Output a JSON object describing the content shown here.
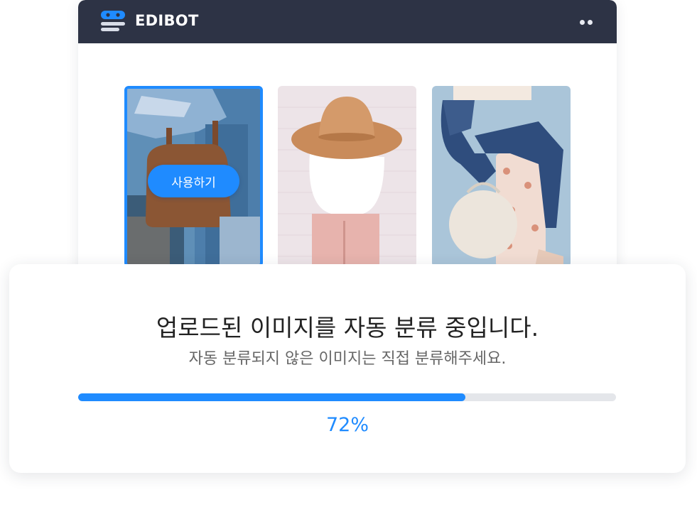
{
  "app": {
    "title": "EDIBOT",
    "logo_icon": "robot-logo-icon",
    "menu_icon": "more-dots-icon"
  },
  "gallery": {
    "cards": [
      {
        "name": "handbag-photo",
        "selected": true,
        "action_label": "사용하기"
      },
      {
        "name": "sun-hat-photo",
        "selected": false
      },
      {
        "name": "round-bag-photo",
        "selected": false
      }
    ]
  },
  "progress": {
    "title": "업로드된 이미지를 자동 분류 중입니다.",
    "subtitle": "자동 분류되지 않은 이미지는 직접 분류해주세요.",
    "value": 72,
    "label": "72%"
  },
  "colors": {
    "accent": "#1f8bff",
    "header_bg": "#2d3345",
    "track": "#e4e6ea"
  }
}
